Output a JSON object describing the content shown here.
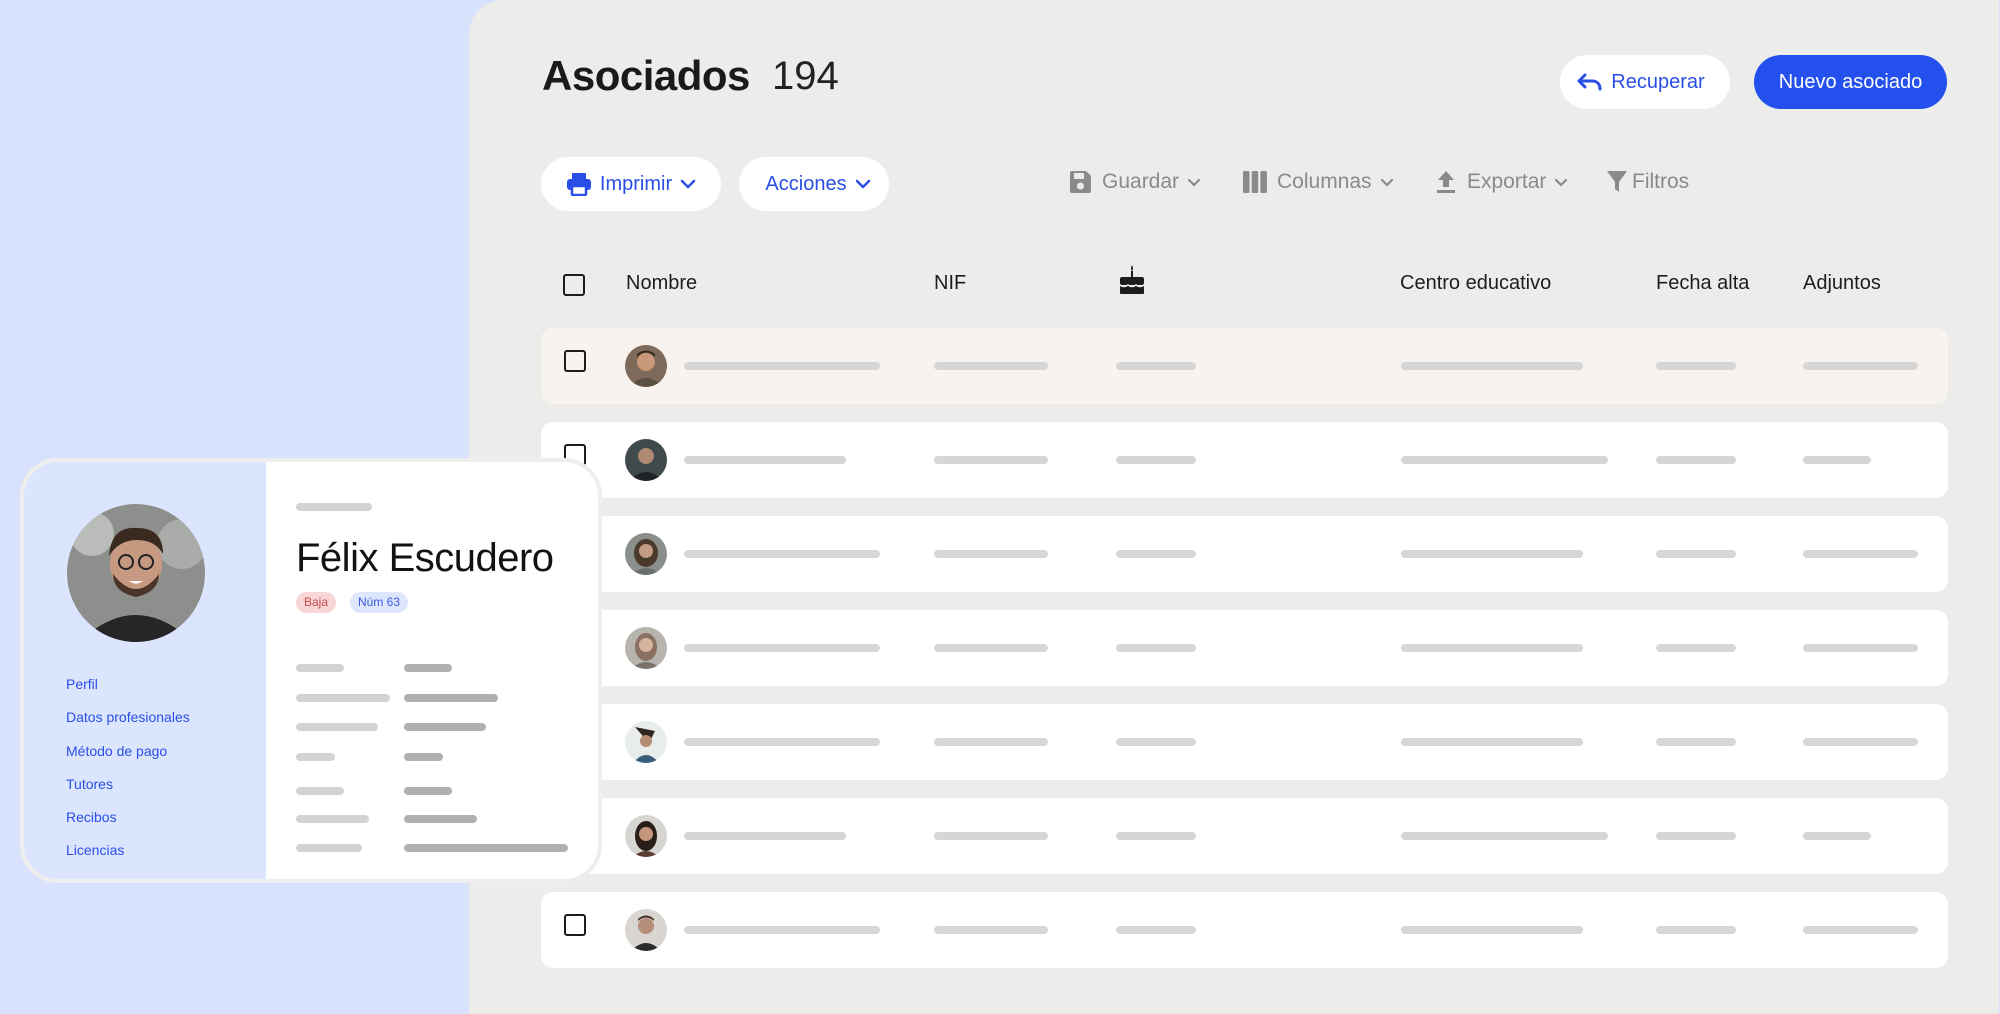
{
  "header": {
    "title": "Asociados",
    "count": "194",
    "recover_label": "Recuperar",
    "new_label": "Nuevo asociado"
  },
  "toolbar": {
    "print_label": "Imprimir",
    "actions_label": "Acciones",
    "save_label": "Guardar",
    "columns_label": "Columnas",
    "export_label": "Exportar",
    "filters_label": "Filtros"
  },
  "table": {
    "columns": [
      "Nombre",
      "NIF",
      "birthday-cake-icon",
      "Centro educativo",
      "Fecha alta",
      "Adjuntos"
    ],
    "row_count": 7
  },
  "profile": {
    "name": "Félix Escudero",
    "status_badge": "Baja",
    "number_badge": "Núm 63",
    "nav": [
      "Perfil",
      "Datos profesionales",
      "Método de pago",
      "Tutores",
      "Recibos",
      "Licencias"
    ]
  },
  "colors": {
    "accent": "#2450ee",
    "panel_bg": "#ececea",
    "page_bg": "#d8e2fd",
    "badge_baja": "#f8d6d6",
    "badge_num": "#dde6fd"
  }
}
